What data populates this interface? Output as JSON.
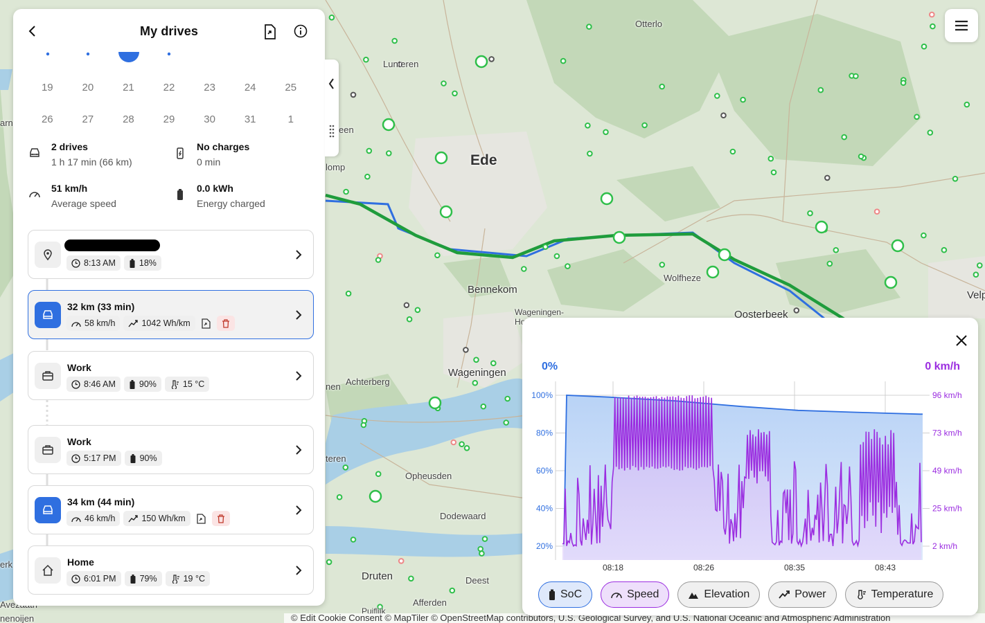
{
  "colors": {
    "accent": "#2f6fe0",
    "speed": "#9b2de0",
    "route_green": "#1f9c3c",
    "charger_green": "#2fbf4a"
  },
  "panel": {
    "title": "My drives",
    "back_icon": "chevron-left-icon",
    "export_icon": "export-file-icon",
    "info_icon": "info-icon",
    "calendar": {
      "rows": [
        [
          "19",
          "20",
          "21",
          "22",
          "23",
          "24",
          "25"
        ],
        [
          "26",
          "27",
          "28",
          "29",
          "30",
          "31",
          "1"
        ]
      ]
    },
    "stats": [
      {
        "icon": "car-icon",
        "value": "2 drives",
        "label": "1 h 17 min (66 km)"
      },
      {
        "icon": "charging-icon",
        "value": "No charges",
        "label": "0 min"
      },
      {
        "icon": "speedometer-icon",
        "value": "51 km/h",
        "label": "Average speed"
      },
      {
        "icon": "battery-icon",
        "value": "0.0 kWh",
        "label": "Energy charged"
      }
    ],
    "items": [
      {
        "type": "place",
        "icon": "location-pin-icon",
        "title": "",
        "time": "8:13 AM",
        "soc": "18%"
      },
      {
        "type": "drive",
        "title": "32 km (33 min)",
        "speed": "58 km/h",
        "consumption": "1042 Wh/km"
      },
      {
        "type": "place",
        "icon": "briefcase-icon",
        "title": "Work",
        "time": "8:46 AM",
        "soc": "90%",
        "temp": "15 °C"
      },
      {
        "type": "place",
        "icon": "briefcase-icon",
        "title": "Work",
        "time": "5:17 PM",
        "soc": "90%"
      },
      {
        "type": "drive",
        "title": "34 km (44 min)",
        "speed": "46 km/h",
        "consumption": "150 Wh/km"
      },
      {
        "type": "place",
        "icon": "home-icon",
        "title": "Home",
        "time": "6:01 PM",
        "soc": "79%",
        "temp": "19 °C"
      }
    ]
  },
  "map": {
    "labels": [
      {
        "text": "Otterlo"
      },
      {
        "text": "Lunteren"
      },
      {
        "text": "Ede"
      },
      {
        "text": "Bennekom"
      },
      {
        "text": "Wolfheze"
      },
      {
        "text": "Oosterbeek"
      },
      {
        "text": "Wageningen"
      },
      {
        "text": "Wageningen-"
      },
      {
        "text": "Ho"
      },
      {
        "text": "Achterberg"
      },
      {
        "text": "Opheusden"
      },
      {
        "text": "Dodewaard"
      },
      {
        "text": "Druten"
      },
      {
        "text": "Deest"
      },
      {
        "text": "Afferden"
      },
      {
        "text": "Puiflijk"
      },
      {
        "text": "Velp"
      },
      {
        "text": "een"
      },
      {
        "text": "lomp"
      },
      {
        "text": "nen"
      },
      {
        "text": "teren"
      },
      {
        "text": "arn"
      },
      {
        "text": "erk"
      },
      {
        "text": "Avezaath"
      },
      {
        "text": "nenoijen"
      }
    ],
    "attribution": "© Edit Cookie Consent  © MapTiler  © OpenStreetMap contributors, U.S. Geological Survey, and U.S. National Oceanic and Atmospheric Administration"
  },
  "chart": {
    "left_value": "0%",
    "right_value": "0 km/h",
    "tabs": [
      {
        "label": "SoC",
        "icon": "battery-icon"
      },
      {
        "label": "Speed",
        "icon": "speedometer-icon"
      },
      {
        "label": "Elevation",
        "icon": "elevation-icon"
      },
      {
        "label": "Power",
        "icon": "trend-icon"
      },
      {
        "label": "Temperature",
        "icon": "thermometer-icon"
      }
    ]
  },
  "chart_data": {
    "type": "line",
    "x_ticks": [
      "08:18",
      "08:26",
      "08:35",
      "08:43"
    ],
    "y_left_ticks": [
      "100%",
      "80%",
      "60%",
      "40%",
      "20%"
    ],
    "y_right_ticks": [
      "96 km/h",
      "73 km/h",
      "49 km/h",
      "25 km/h",
      "2 km/h"
    ],
    "x_range_min": [
      13.2,
      46.2
    ],
    "y_left_range": [
      20,
      100
    ],
    "y_right_range": [
      2,
      96
    ],
    "grid": true,
    "series": [
      {
        "name": "SoC",
        "axis": "left",
        "x": [
          13.2,
          14,
          18,
          24,
          30,
          35,
          40,
          46
        ],
        "y": [
          20,
          100,
          99,
          97,
          94,
          92,
          91,
          90
        ]
      },
      {
        "name": "Speed",
        "axis": "right",
        "x_start": 13.2,
        "x_end": 46.2
      }
    ]
  }
}
